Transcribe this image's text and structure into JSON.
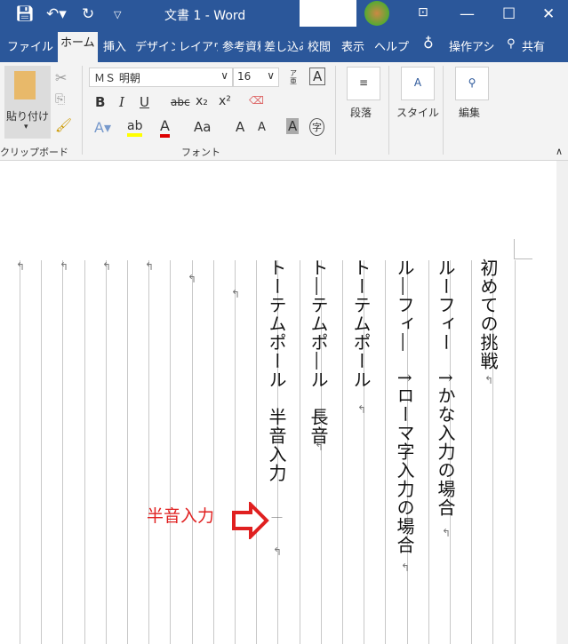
{
  "titlebar": {
    "title": "文書 1  -  Word",
    "save_icon": "save-icon",
    "undo_icon": "undo-icon",
    "redo_icon": "redo-icon"
  },
  "tabs": [
    "ファイル",
    "ホーム",
    "挿入",
    "デザイン",
    "レイアウト",
    "参考資料",
    "差し込み",
    "校閲",
    "表示",
    "ヘルプ"
  ],
  "tell_me": "操作アシ",
  "share": "共有",
  "ribbon": {
    "paste": "貼り付け",
    "clipboard_group": "クリップボード",
    "font_name": "ＭＳ 明朝",
    "font_size": "16",
    "font_group": "フォント",
    "paragraph": "段落",
    "styles": "スタイル",
    "editing": "編集",
    "bold": "B",
    "italic": "I",
    "underline": "U",
    "strike": "abc",
    "sub": "x₂",
    "sup": "x²",
    "case": "Aa",
    "grow": "A",
    "shrink": "A",
    "shade": "A",
    "enclose": "字",
    "box": "A",
    "ruby": "ア亜"
  },
  "document": {
    "columns": [
      "初めての挑戦",
      "ルーフィー　↑かな入力の場合",
      "ル―フィ―　↑ローマ字入力の場合",
      "トーテムポール",
      "ト―テムポ―ル　長音",
      "トーテムポール　半音入力",
      "｜"
    ],
    "annotation": "半音入力",
    "annotation_color": "#e02020",
    "return_mark": "↵"
  }
}
